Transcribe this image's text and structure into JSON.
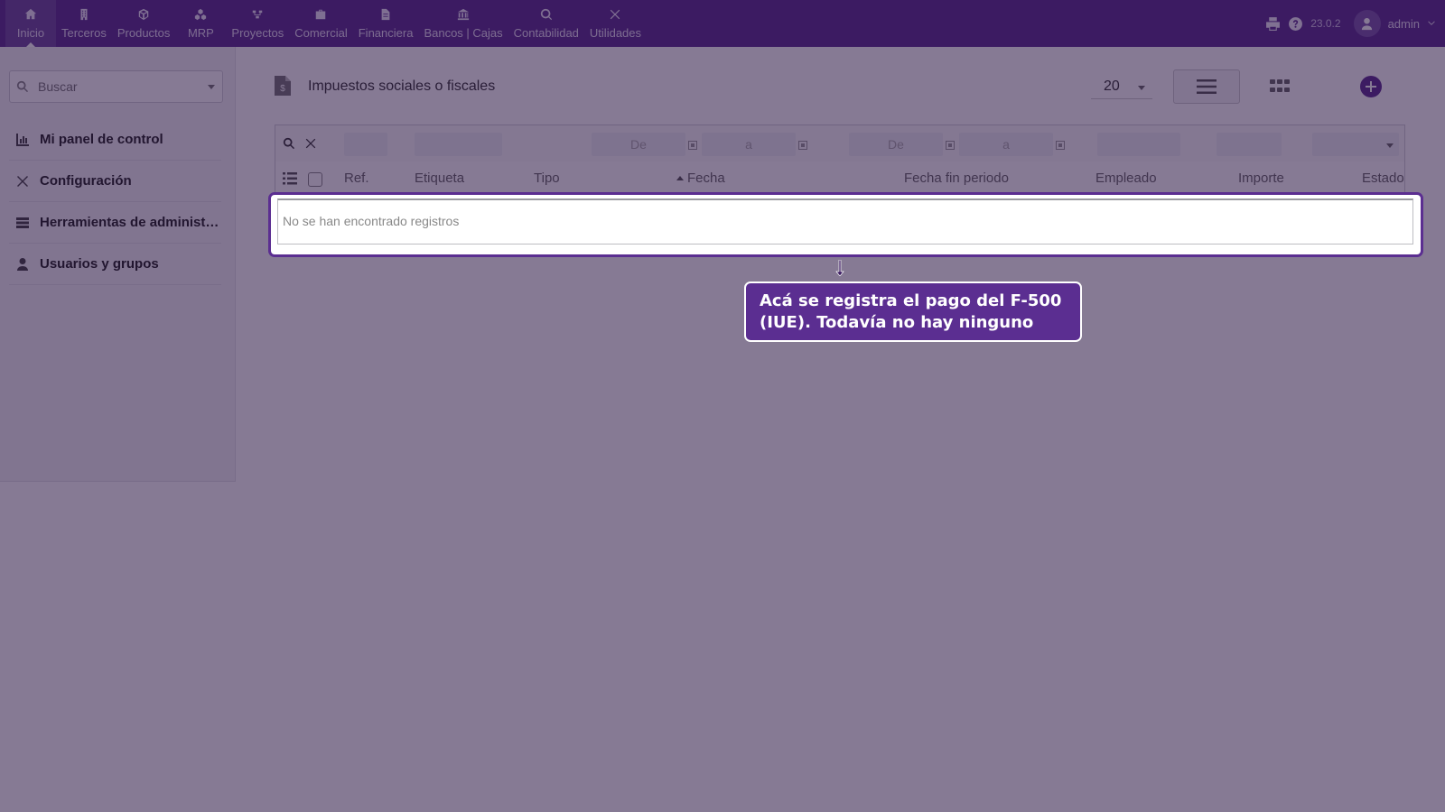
{
  "topnav": {
    "tabs": [
      {
        "label": "Inicio",
        "icon": "home-icon",
        "active": true
      },
      {
        "label": "Terceros",
        "icon": "building-icon"
      },
      {
        "label": "Productos",
        "icon": "cube-icon"
      },
      {
        "label": "MRP",
        "icon": "cubes-icon"
      },
      {
        "label": "Proyectos",
        "icon": "sitemap-icon"
      },
      {
        "label": "Comercial",
        "icon": "briefcase-icon"
      },
      {
        "label": "Financiera",
        "icon": "file-invoice-icon"
      },
      {
        "label": "Bancos | Cajas",
        "icon": "bank-icon"
      },
      {
        "label": "Contabilidad",
        "icon": "search-dollar-icon"
      },
      {
        "label": "Utilidades",
        "icon": "tools-icon"
      }
    ],
    "version": "23.0.2",
    "user": "admin"
  },
  "sidebar": {
    "search_placeholder": "Buscar",
    "items": [
      {
        "label": "Mi panel de control",
        "icon": "chart-icon"
      },
      {
        "label": "Configuración",
        "icon": "tools-icon"
      },
      {
        "label": "Herramientas de administración",
        "icon": "server-icon"
      },
      {
        "label": "Usuarios y grupos",
        "icon": "user-icon"
      }
    ]
  },
  "main": {
    "title": "Impuestos sociales o fiscales",
    "limit": "20",
    "filters": {
      "date_from": "De",
      "date_to": "a"
    },
    "columns": [
      "Ref.",
      "Etiqueta",
      "Tipo",
      "Fecha",
      "Fecha fin periodo",
      "Empleado",
      "Importe",
      "Estado"
    ],
    "sorted_column": "Fecha",
    "empty_message": "No se han encontrado registros"
  },
  "tour": {
    "tooltip_text": "Acá se registra el pago del F-500 (IUE). Todavía no hay ninguno"
  },
  "colors": {
    "brand": "#5b2e91"
  }
}
